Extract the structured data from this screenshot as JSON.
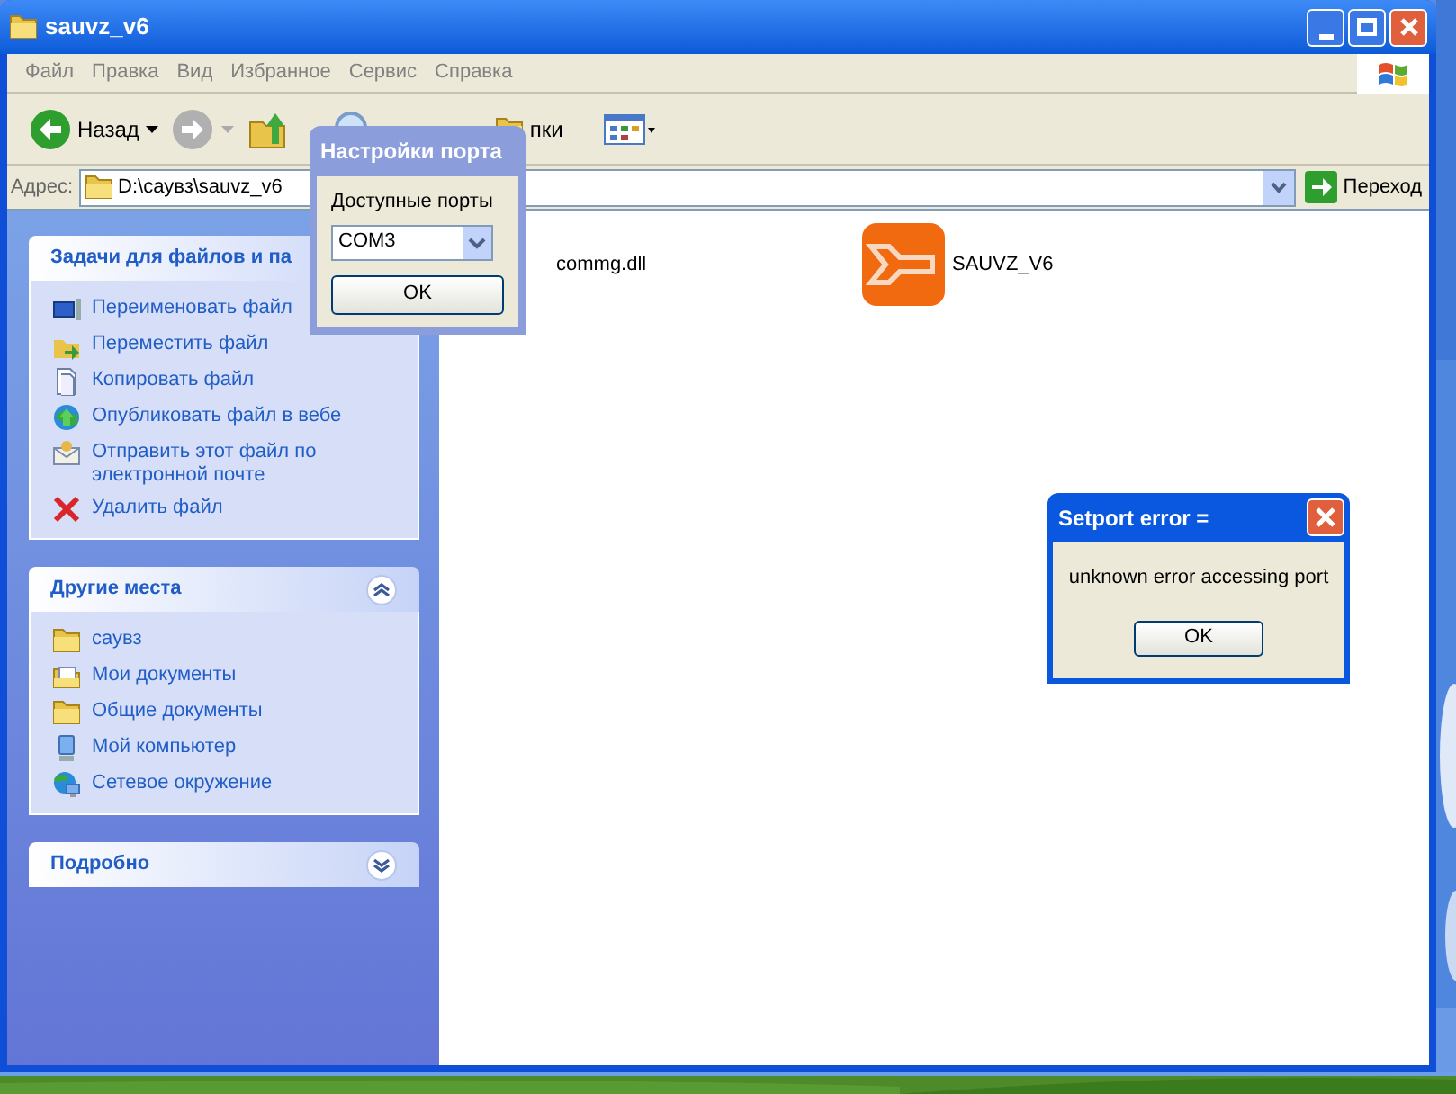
{
  "window": {
    "title": "sauvz_v6"
  },
  "menu": [
    "Файл",
    "Правка",
    "Вид",
    "Избранное",
    "Сервис",
    "Справка"
  ],
  "toolbar": [
    {
      "kind": "back",
      "label": "Назад"
    },
    {
      "kind": "forward"
    },
    {
      "kind": "up"
    },
    {
      "kind": "search"
    },
    {
      "kind": "folders",
      "label": "пки"
    },
    {
      "kind": "views"
    }
  ],
  "address": {
    "label": "Адрес:",
    "value": "D:\\саувз\\sauvz_v6",
    "go_label": "Переход"
  },
  "sidebar": {
    "panels": [
      {
        "title": "Задачи для файлов и па",
        "expanded": true,
        "chevron_visible": false,
        "items": [
          "Переименовать файл",
          "Переместить файл",
          "Копировать файл",
          "Опубликовать файл в вебе",
          "Отправить этот файл по электронной почте",
          "Удалить файл"
        ]
      },
      {
        "title": "Другие места",
        "expanded": true,
        "items": [
          "саувз",
          "Мои документы",
          "Общие документы",
          "Мой компьютер",
          "Сетевое окружение"
        ]
      },
      {
        "title": "Подробно",
        "expanded": false
      }
    ]
  },
  "files": [
    {
      "name": "commg.dll",
      "kind": "library"
    },
    {
      "name": "SAUVZ_V6",
      "kind": "application"
    }
  ],
  "port_dialog": {
    "title": "Настройки порта",
    "label": "Доступные порты",
    "port": "COM3",
    "button": "OK"
  },
  "error_dialog": {
    "title": "Setport error =",
    "message": "unknown error accessing port",
    "button": "OK"
  }
}
